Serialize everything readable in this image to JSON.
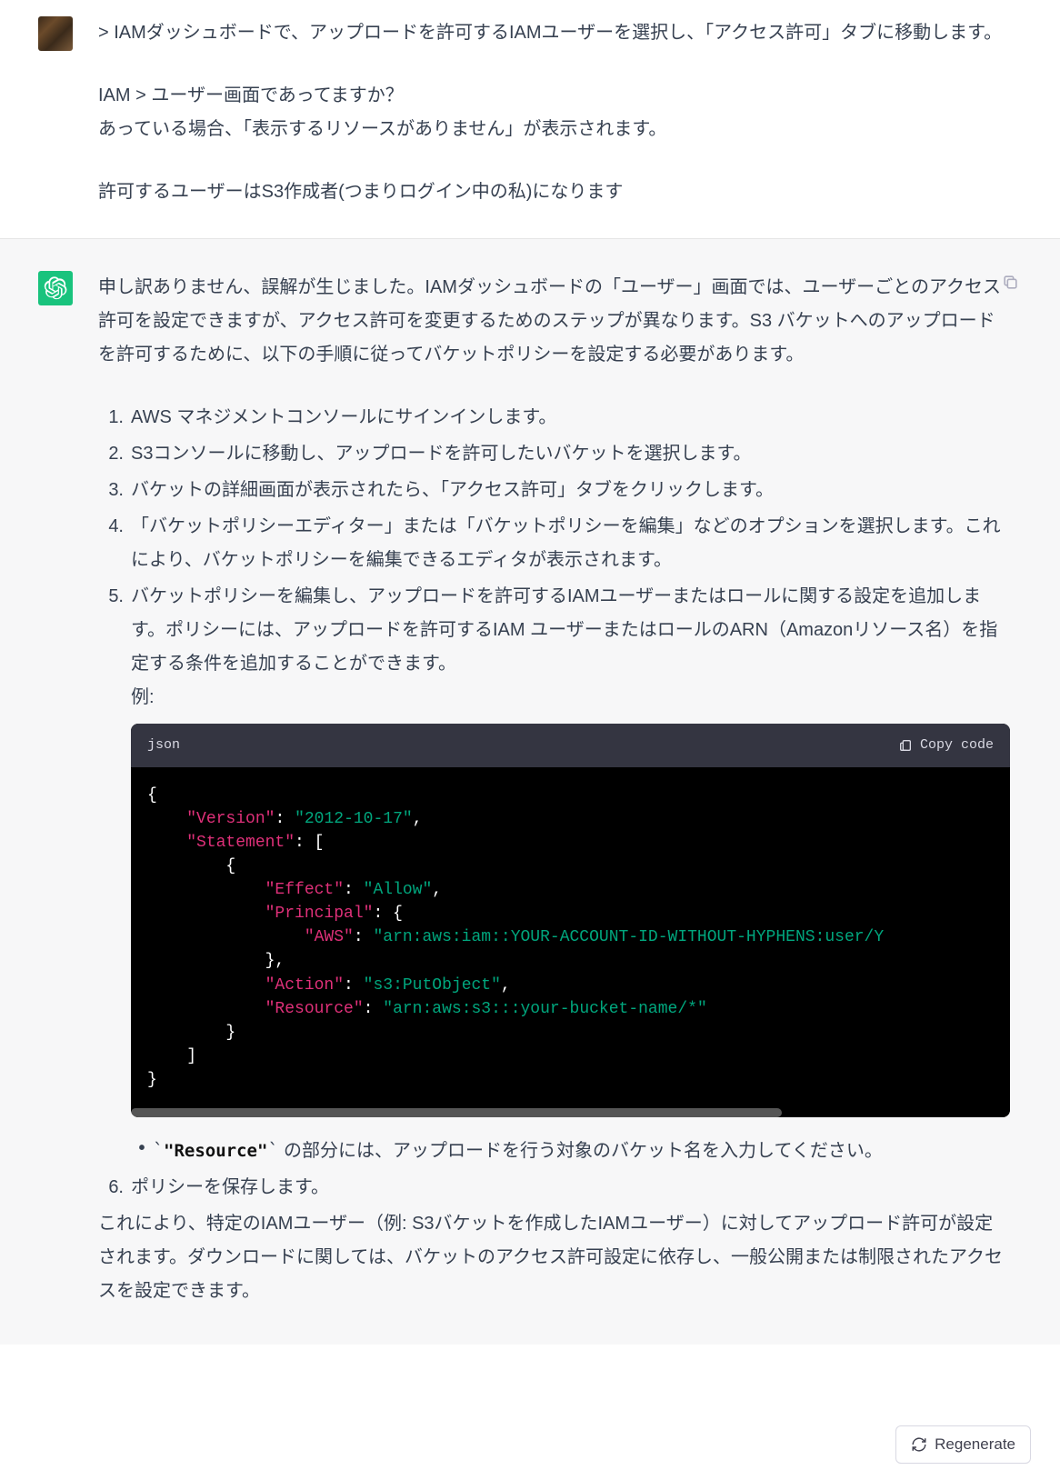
{
  "user": {
    "line1": "> IAMダッシュボードで、アップロードを許可するIAMユーザーを選択し、「アクセス許可」タブに移動します。",
    "line2": "IAM > ユーザー画面であってますか？",
    "line3": "あっている場合、「表示するリソースがありません」が表示されます。",
    "line4": "許可するユーザーはS3作成者(つまりログイン中の私)になります"
  },
  "assistant": {
    "intro": "申し訳ありません、誤解が生じました。IAMダッシュボードの「ユーザー」画面では、ユーザーごとのアクセス許可を設定できますが、アクセス許可を変更するためのステップが異なります。S3 バケットへのアップロードを許可するために、以下の手順に従ってバケットポリシーを設定する必要があります。",
    "steps": {
      "n1": "1.",
      "t1": "AWS マネジメントコンソールにサインインします。",
      "n2": "2.",
      "t2": "S3コンソールに移動し、アップロードを許可したいバケットを選択します。",
      "n3": "3.",
      "t3": "バケットの詳細画面が表示されたら、「アクセス許可」タブをクリックします。",
      "n4": "4.",
      "t4": "「バケットポリシーエディター」または「バケットポリシーを編集」などのオプションを選択します。これにより、バケットポリシーを編集できるエディタが表示されます。",
      "n5": "5.",
      "t5": "バケットポリシーを編集し、アップロードを許可するIAMユーザーまたはロールに関する設定を追加します。ポリシーには、アップロードを許可するIAM ユーザーまたはロールのARN（Amazonリソース名）を指定する条件を追加することができます。",
      "t5b": "例:",
      "n6": "6.",
      "t6": "ポリシーを保存します。"
    },
    "code": {
      "lang": "json",
      "copy_label": "Copy code",
      "k_version": "\"Version\"",
      "v_version": "\"2012-10-17\"",
      "k_statement": "\"Statement\"",
      "k_effect": "\"Effect\"",
      "v_effect": "\"Allow\"",
      "k_principal": "\"Principal\"",
      "k_aws": "\"AWS\"",
      "v_aws": "\"arn:aws:iam::YOUR-ACCOUNT-ID-WITHOUT-HYPHENS:user/Y",
      "k_action": "\"Action\"",
      "v_action": "\"s3:PutObject\"",
      "k_resource": "\"Resource\"",
      "v_resource": "\"arn:aws:s3:::your-bucket-name/*\""
    },
    "bullet": {
      "code_token": "\"Resource\"",
      "tail": " の部分には、アップロードを行う対象のバケット名を入力してください。"
    },
    "outro": "これにより、特定のIAMユーザー（例: S3バケットを作成したIAMユーザー）に対してアップロード許可が設定されます。ダウンロードに関しては、バケットのアクセス許可設定に依存し、一般公開または制限されたアクセスを設定できます。"
  },
  "regen_label": "Regenerate"
}
